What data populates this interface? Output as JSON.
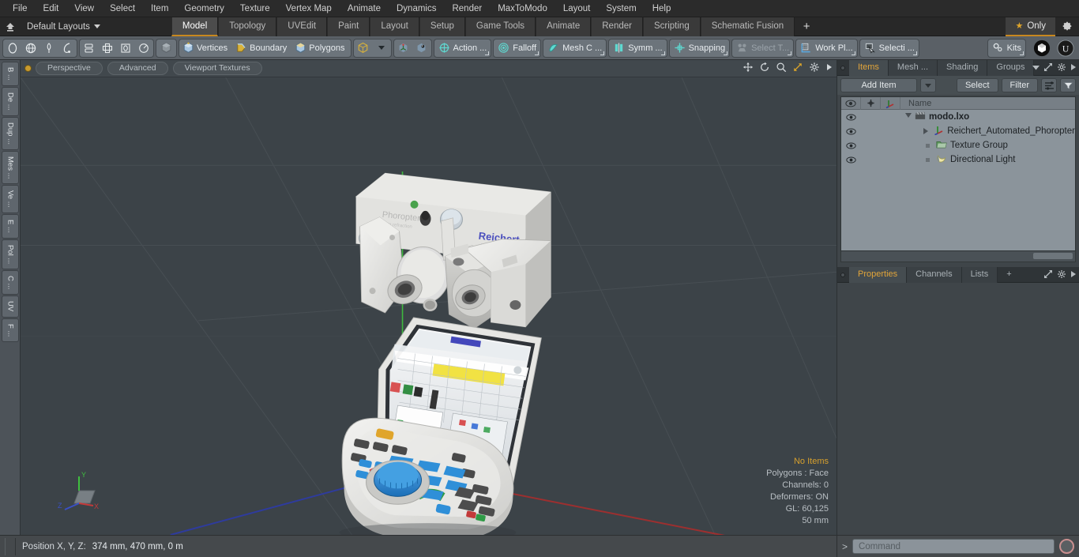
{
  "menu": {
    "items": [
      "File",
      "Edit",
      "View",
      "Select",
      "Item",
      "Geometry",
      "Texture",
      "Vertex Map",
      "Animate",
      "Dynamics",
      "Render",
      "MaxToModo",
      "Layout",
      "System",
      "Help"
    ]
  },
  "layoutbar": {
    "home_icon": "home-up-icon",
    "layouts_label": "Default Layouts",
    "tabs": [
      {
        "label": "Model",
        "active": true
      },
      {
        "label": "Topology",
        "active": false
      },
      {
        "label": "UVEdit",
        "active": false
      },
      {
        "label": "Paint",
        "active": false
      },
      {
        "label": "Layout",
        "active": false
      },
      {
        "label": "Setup",
        "active": false
      },
      {
        "label": "Game Tools",
        "active": false
      },
      {
        "label": "Animate",
        "active": false
      },
      {
        "label": "Render",
        "active": false
      },
      {
        "label": "Scripting",
        "active": false
      },
      {
        "label": "Schematic Fusion",
        "active": false
      }
    ],
    "add_tab_label": "+",
    "only_label": "Only",
    "star_glyph": "★",
    "gear_icon": "gear-icon"
  },
  "toolbar": {
    "selection_modes": [
      "circle-select-icon",
      "globe-select-icon",
      "lasso-paint-icon",
      "lasso-select-icon"
    ],
    "falloff_modes": [
      "center-align-icon",
      "cross-align-icon",
      "square-align-icon",
      "radial-align-icon"
    ],
    "component_group": [
      {
        "label": "",
        "icon": "cube-grey-icon"
      },
      {
        "label": "Vertices",
        "icon": "vertices-icon"
      },
      {
        "label": "Boundary",
        "icon": "boundary-icon"
      },
      {
        "label": "Polygons",
        "icon": "polygons-icon"
      },
      {
        "label": "",
        "icon": "cube-outline-icon",
        "has_caret": true
      }
    ],
    "pivot_icons": [
      "pivot-axis-icon",
      "pivot-center-icon"
    ],
    "buttons": [
      {
        "label": "Action  ...",
        "icon": "action-center-icon",
        "dim": false
      },
      {
        "label": "Falloff",
        "icon": "falloff-icon",
        "dim": false
      },
      {
        "label": "Mesh C ...",
        "icon": "mesh-constraint-icon",
        "dim": false
      },
      {
        "label": "Symm ...",
        "icon": "symmetry-icon",
        "dim": false
      },
      {
        "label": "Snapping",
        "icon": "snapping-icon",
        "dim": false
      },
      {
        "label": "Select T...",
        "icon": "select-through-icon",
        "dim": true
      },
      {
        "label": "Work Pl...",
        "icon": "work-plane-icon",
        "dim": false
      },
      {
        "label": "Selecti ...",
        "icon": "selection-set-icon",
        "dim": false
      },
      {
        "label": "Kits",
        "icon": "kits-gear-icon",
        "dim": false
      }
    ],
    "app_icons": [
      "modo-logo-icon",
      "unreal-engine-icon"
    ]
  },
  "left_strip": {
    "tabs": [
      "B ...",
      "De ...",
      "Dup ...",
      "Mes ...",
      "Ve ...",
      "E ...",
      "Pol ...",
      "C ...",
      "UV",
      "F ..."
    ]
  },
  "viewport": {
    "status_dot_color": "#c79a2e",
    "buttons": [
      "Perspective",
      "Advanced",
      "Viewport Textures"
    ],
    "nav_icons": [
      "pan-icon",
      "rotate-icon",
      "zoom-icon",
      "fit-icon",
      "viewport-gear-icon",
      "viewport-more-icon"
    ],
    "background_color": "#3c4348",
    "stats": {
      "selection": "No Items",
      "polygons": "Polygons : Face",
      "channels": "Channels: 0",
      "deformers": "Deformers: ON",
      "gl": "GL: 60,125",
      "grid": "50 mm"
    },
    "axis_gizmo": {
      "x": "X",
      "y": "Y",
      "z": "Z",
      "x_color": "#c43a3a",
      "y_color": "#3ec43a",
      "z_color": "#3a50c4"
    }
  },
  "right_panel": {
    "top_tabs": [
      {
        "label": "Items",
        "active": true
      },
      {
        "label": "Mesh ...",
        "active": false
      },
      {
        "label": "Shading",
        "active": false
      },
      {
        "label": "Groups",
        "active": false
      }
    ],
    "top_tab_icons": [
      "chevron-down-icon",
      "expand-icon",
      "panel-gear-icon",
      "panel-more-icon"
    ],
    "controls": {
      "add_item": "Add Item",
      "add_item_caret": "caret-down-icon",
      "select": "Select",
      "filter": "Filter",
      "list_icon": "list-options-icon",
      "funnel_icon": "funnel-icon"
    },
    "tree_headers": {
      "eye": "visibility-icon",
      "lock": "lock-icon",
      "axis": "axis-icon",
      "name": "Name"
    },
    "tree_rows": [
      {
        "label": "modo.lxo",
        "icon": "scene-clapper-icon",
        "depth": 0,
        "expander": "down",
        "bold": true
      },
      {
        "label": "Reichert_Automated_Phoropter",
        "icon": "mesh-axis-icon",
        "depth": 1,
        "expander": "right",
        "bold": false
      },
      {
        "label": "Texture Group",
        "icon": "texture-group-icon",
        "depth": 1,
        "expander": "none",
        "bold": false
      },
      {
        "label": "Directional Light",
        "icon": "directional-light-icon",
        "depth": 1,
        "expander": "none",
        "bold": false
      }
    ],
    "bottom_tabs": [
      {
        "label": "Properties",
        "active": true
      },
      {
        "label": "Channels",
        "active": false
      },
      {
        "label": "Lists",
        "active": false
      },
      {
        "label": "+",
        "active": false
      }
    ],
    "bottom_tab_icons": [
      "expand-icon",
      "panel-gear-icon",
      "panel-more-icon"
    ]
  },
  "status_bar": {
    "position_label": "Position X, Y, Z:",
    "position_value": "374 mm, 470 mm, 0 m",
    "command_prompt": ">",
    "command_placeholder": "Command",
    "record_icon": "record-icon"
  }
}
